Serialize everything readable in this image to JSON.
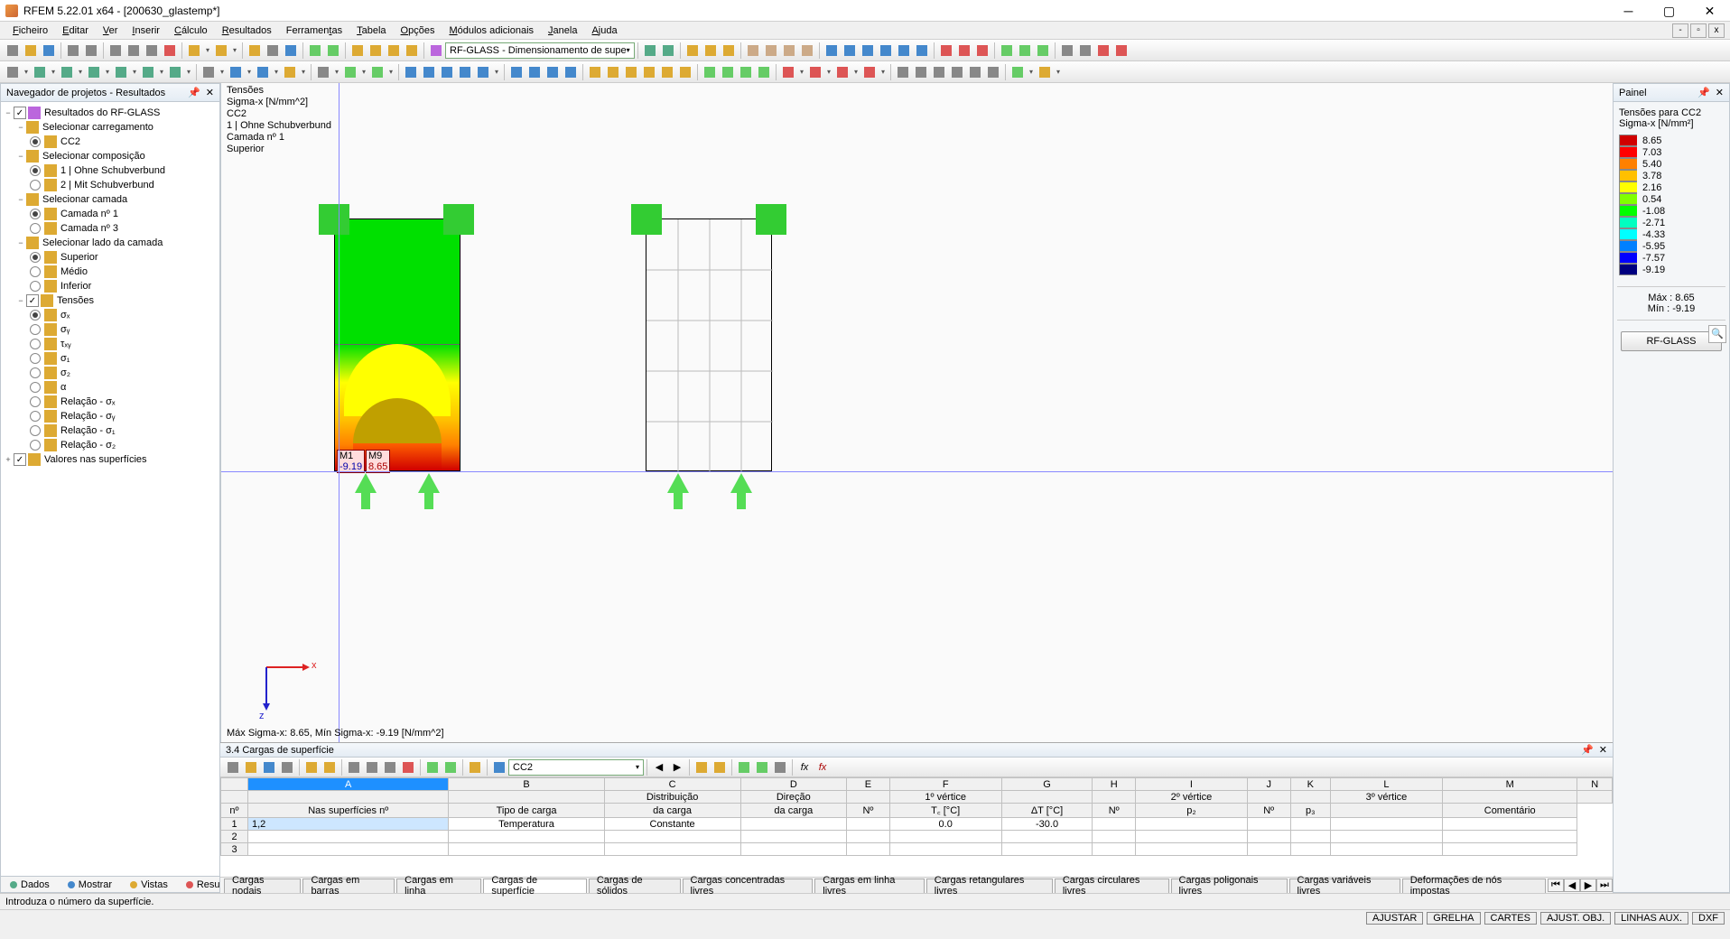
{
  "window": {
    "title": "RFEM 5.22.01 x64 - [200630_glastemp*]"
  },
  "menu": [
    "Ficheiro",
    "Editar",
    "Ver",
    "Inserir",
    "Cálculo",
    "Resultados",
    "Ferramentas",
    "Tabela",
    "Opções",
    "Módulos adicionais",
    "Janela",
    "Ajuda"
  ],
  "toolbar_combo_module": "RF-GLASS - Dimensionamento de supe",
  "left_panel": {
    "title": "Navegador de projetos - Resultados",
    "root": "Resultados do RF-GLASS",
    "groups": {
      "carregamento": {
        "label": "Selecionar carregamento",
        "items": [
          "CC2"
        ],
        "selected": "CC2"
      },
      "composicao": {
        "label": "Selecionar composição",
        "items": [
          "1 | Ohne Schubverbund",
          "2 | Mit Schubverbund"
        ],
        "selected": "1 | Ohne Schubverbund"
      },
      "camada": {
        "label": "Selecionar camada",
        "items": [
          "Camada nº 1",
          "Camada nº 3"
        ],
        "selected": "Camada nº 1"
      },
      "lado": {
        "label": "Selecionar lado da camada",
        "items": [
          "Superior",
          "Médio",
          "Inferior"
        ],
        "selected": "Superior"
      },
      "tensoes": {
        "label": "Tensões",
        "items": [
          "σₓ",
          "σᵧ",
          "τₓᵧ",
          "σ₁",
          "σ₂",
          "α",
          "Relação - σₓ",
          "Relação - σᵧ",
          "Relação - σ₁",
          "Relação - σ₂"
        ],
        "selected": "σₓ"
      },
      "valores": {
        "label": "Valores nas superfícies"
      }
    }
  },
  "viewport": {
    "overlay": {
      "l1": "Tensões",
      "l2": "Sigma-x [N/mm^2]",
      "l3": "CC2",
      "l4": "1 | Ohne Schubverbund",
      "l5": "Camada nº 1",
      "l6": "Superior"
    },
    "footer": "Máx Sigma-x: 8.65, Mín Sigma-x: -9.19 [N/mm^2]",
    "label_m1_name": "M1",
    "label_m1_val": "-9.19",
    "label_m9_name": "M9",
    "label_m9_val": "8.65",
    "axis_x": "x",
    "axis_z": "z"
  },
  "right_panel": {
    "title": "Painel",
    "legend_title": "Tensões para CC2",
    "legend_sub": "Sigma-x [N/mm²]",
    "stops": [
      {
        "color": "#d00000",
        "v": "8.65"
      },
      {
        "color": "#ff0000",
        "v": "7.03"
      },
      {
        "color": "#ff8000",
        "v": "5.40"
      },
      {
        "color": "#ffc000",
        "v": "3.78"
      },
      {
        "color": "#ffff00",
        "v": "2.16"
      },
      {
        "color": "#80ff00",
        "v": "0.54"
      },
      {
        "color": "#00ff00",
        "v": "-1.08"
      },
      {
        "color": "#00ffc0",
        "v": "-2.71"
      },
      {
        "color": "#00ffff",
        "v": "-4.33"
      },
      {
        "color": "#0080ff",
        "v": "-5.95"
      },
      {
        "color": "#0000ff",
        "v": "-7.57"
      },
      {
        "color": "#000080",
        "v": "-9.19"
      }
    ],
    "max_label": "Máx  :",
    "max_val": "8.65",
    "min_label": "Mín  :",
    "min_val": "-9.19",
    "button": "RF-GLASS"
  },
  "table": {
    "title": "3.4 Cargas de superfície",
    "combo": "CC2",
    "col_letters": [
      "A",
      "B",
      "C",
      "D",
      "E",
      "F",
      "G",
      "H",
      "I",
      "J",
      "K",
      "L",
      "M",
      "N"
    ],
    "headers_row1": [
      "",
      "",
      "Distribuição",
      "Direção",
      "",
      "1º vértice",
      "",
      "",
      "2º vértice",
      "",
      "",
      "3º vértice",
      "",
      ""
    ],
    "headers_row2": [
      "nº",
      "Nas superfícies nº",
      "Tipo de carga",
      "da carga",
      "da carga",
      "Nº",
      "T꜀ [°C]",
      "ΔT [°C]",
      "Nº",
      "p₂",
      "Nº",
      "p₃",
      "",
      "Comentário"
    ],
    "rows": [
      [
        "1",
        "1,2",
        "Temperatura",
        "Constante",
        "",
        "",
        "0.0",
        "-30.0",
        "",
        "",
        "",
        "",
        "",
        ""
      ],
      [
        "2",
        "",
        "",
        "",
        "",
        "",
        "",
        "",
        "",
        "",
        "",
        "",
        "",
        ""
      ],
      [
        "3",
        "",
        "",
        "",
        "",
        "",
        "",
        "",
        "",
        "",
        "",
        "",
        "",
        ""
      ]
    ]
  },
  "bottom_tabs": [
    "Cargas nodais",
    "Cargas em barras",
    "Cargas em linha",
    "Cargas de superfície",
    "Cargas de sólidos",
    "Cargas concentradas livres",
    "Cargas em linha livres",
    "Cargas retangulares livres",
    "Cargas circulares livres",
    "Cargas poligonais livres",
    "Cargas variáveis livres",
    "Deformações de nós impostas"
  ],
  "bottom_tabs_active": "Cargas de superfície",
  "view_tabs": [
    {
      "label": "Dados",
      "color": "#5a8"
    },
    {
      "label": "Mostrar",
      "color": "#48c"
    },
    {
      "label": "Vistas",
      "color": "#da3"
    },
    {
      "label": "Resultados",
      "color": "#d55"
    }
  ],
  "status": {
    "hint": "Introduza o número da superfície.",
    "toggles": [
      "AJUSTAR",
      "GRELHA",
      "CARTES",
      "AJUST. OBJ.",
      "LINHAS AUX.",
      "DXF"
    ]
  }
}
